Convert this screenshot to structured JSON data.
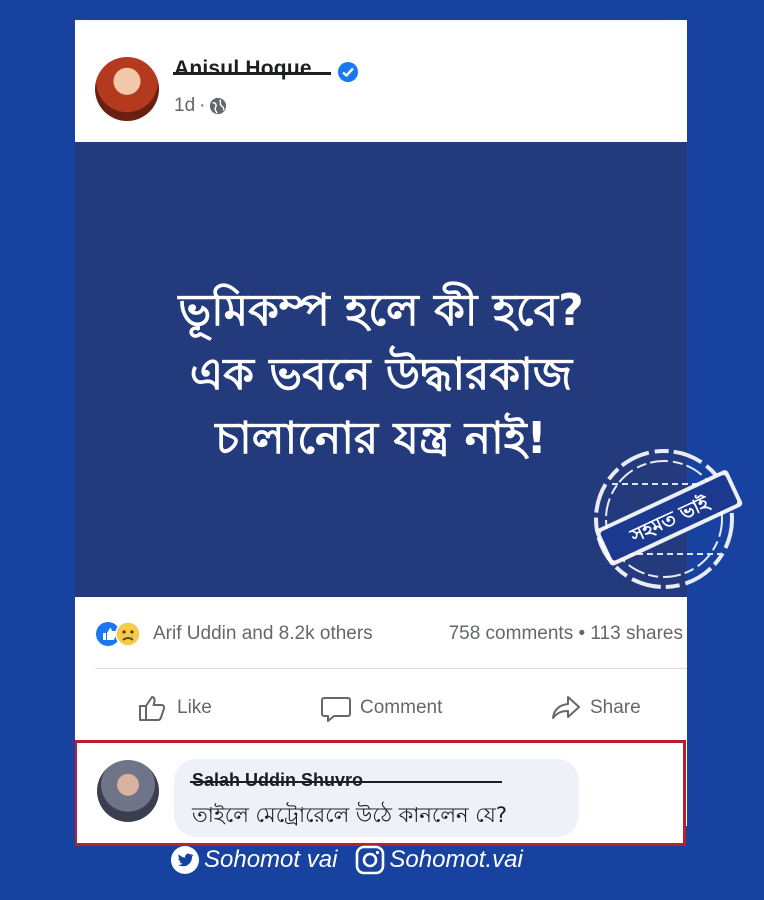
{
  "post": {
    "author": "Anisul Hoque",
    "time": "1d",
    "meta_sep": "·",
    "headline_lines": [
      "ভূমিকম্প হলে কী হবে?",
      "এক ভবনে উদ্ধারকাজ",
      "চালানোর যন্ত্র নাই!"
    ]
  },
  "stats": {
    "reactions_text": "Arif Uddin and 8.2k others",
    "counts_text": "758 comments • 113 shares"
  },
  "actions": {
    "like": "Like",
    "comment": "Comment",
    "share": "Share"
  },
  "comment": {
    "name": "Salah Uddin Shuvro",
    "text": "তাইলে মেট্রোরেলে উঠে কানলেন যে?"
  },
  "stamp": {
    "text": "সহমত ভাই"
  },
  "footer": {
    "twitter_handle": "Sohomot vai",
    "instagram_handle": "Sohomot.vai"
  },
  "colors": {
    "background": "#1742a0",
    "post_image_bg": "#233a7d",
    "comment_border": "#b81f2a",
    "facebook_blue": "#1877f2"
  }
}
